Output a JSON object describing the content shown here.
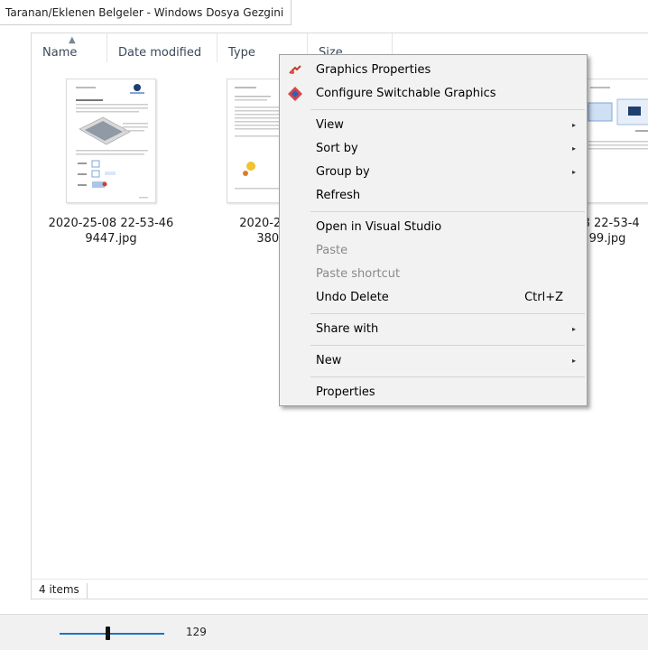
{
  "window": {
    "title": "Taranan/Eklenen Belgeler - Windows Dosya Gezgini"
  },
  "columns": [
    "Name",
    "Date modified",
    "Type",
    "Size"
  ],
  "files": [
    {
      "name_line1": "2020-25-08 22-53-46",
      "name_line2": "9447.jpg"
    },
    {
      "name_line1": "2020-25-08",
      "name_line2": "3800."
    },
    {
      "name_line1": "08 22-53-4",
      "name_line2": "99.jpg"
    }
  ],
  "status": {
    "item_count": "4 items"
  },
  "zoom": {
    "value": "129",
    "level_fraction": 0.44
  },
  "context_menu": {
    "graphics_properties": "Graphics Properties",
    "configure_switchable": "Configure Switchable Graphics",
    "view": "View",
    "sort_by": "Sort by",
    "group_by": "Group by",
    "refresh": "Refresh",
    "open_vs": "Open in Visual Studio",
    "paste": "Paste",
    "paste_shortcut": "Paste shortcut",
    "undo_delete": "Undo Delete",
    "undo_shortcut": "Ctrl+Z",
    "share_with": "Share with",
    "new": "New",
    "properties": "Properties"
  },
  "icons": {
    "graphics": "intel-graphics-icon",
    "switchable": "amd-switchable-icon",
    "submenu_arrow": "▸"
  }
}
